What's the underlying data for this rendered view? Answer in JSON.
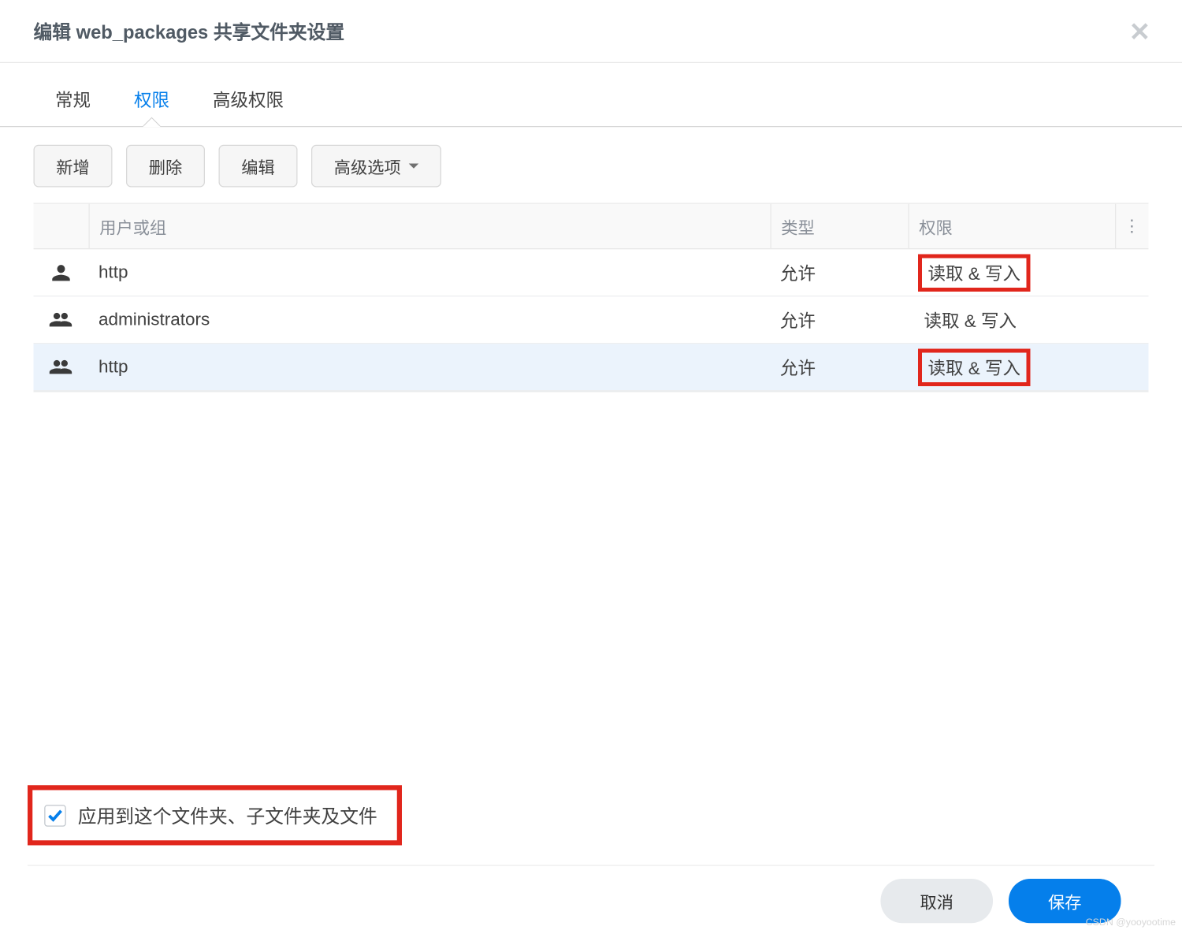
{
  "header": {
    "title": "编辑 web_packages 共享文件夹设置",
    "close_aria": "close"
  },
  "tabs": [
    {
      "label": "常规",
      "active": false
    },
    {
      "label": "权限",
      "active": true
    },
    {
      "label": "高级权限",
      "active": false
    }
  ],
  "toolbar": {
    "add": "新增",
    "del": "删除",
    "edit": "编辑",
    "adv": "高级选项"
  },
  "table": {
    "headers": {
      "user_or_group": "用户或组",
      "type": "类型",
      "permission": "权限"
    },
    "rows": [
      {
        "icon": "user",
        "name": "http",
        "type": "允许",
        "perm": "读取 & 写入",
        "highlight": true,
        "selected": false
      },
      {
        "icon": "group",
        "name": "administrators",
        "type": "允许",
        "perm": "读取 & 写入",
        "highlight": false,
        "selected": false
      },
      {
        "icon": "group",
        "name": "http",
        "type": "允许",
        "perm": "读取 & 写入",
        "highlight": true,
        "selected": true
      }
    ]
  },
  "apply_checkbox": {
    "checked": true,
    "label": "应用到这个文件夹、子文件夹及文件"
  },
  "buttons": {
    "cancel": "取消",
    "save": "保存"
  },
  "watermark": "CSDN @yooyootime"
}
